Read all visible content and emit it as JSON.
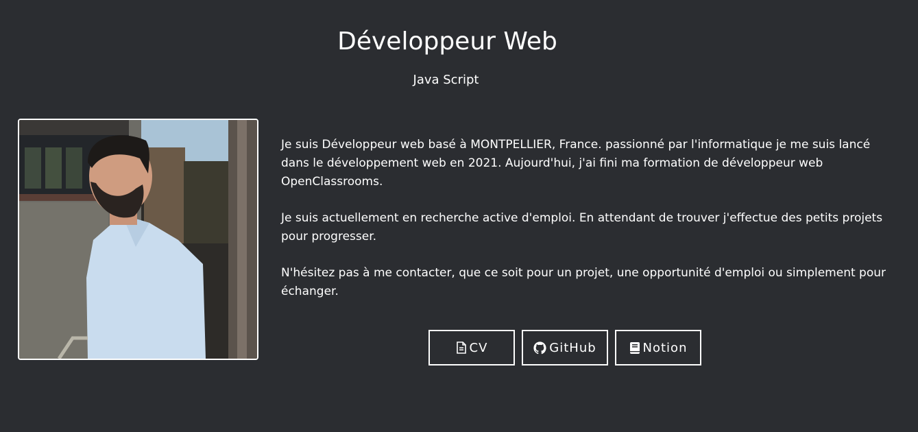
{
  "header": {
    "title": "Développeur Web",
    "subtitle": "Java Script"
  },
  "profile": {
    "photo_icon": "profile-photo"
  },
  "bio": {
    "paragraphs": [
      "Je suis Développeur web basé à MONTPELLIER, France. passionné par l'informatique je me suis lancé dans le développement web en 2021. Aujourd'hui, j'ai fini ma formation de développeur web OpenClassrooms.",
      "Je suis actuellement en recherche active d'emploi. En attendant de trouver j'effectue des petits projets pour progresser.",
      "N'hésitez pas à me contacter, que ce soit pour un projet, une opportunité d'emploi ou simplement pour échanger."
    ]
  },
  "buttons": [
    {
      "label": "CV",
      "icon": "file-icon"
    },
    {
      "label": "GitHub",
      "icon": "github-icon"
    },
    {
      "label": "Notion",
      "icon": "book-icon"
    }
  ],
  "colors": {
    "background": "#2b2d31",
    "text": "#ffffff"
  }
}
